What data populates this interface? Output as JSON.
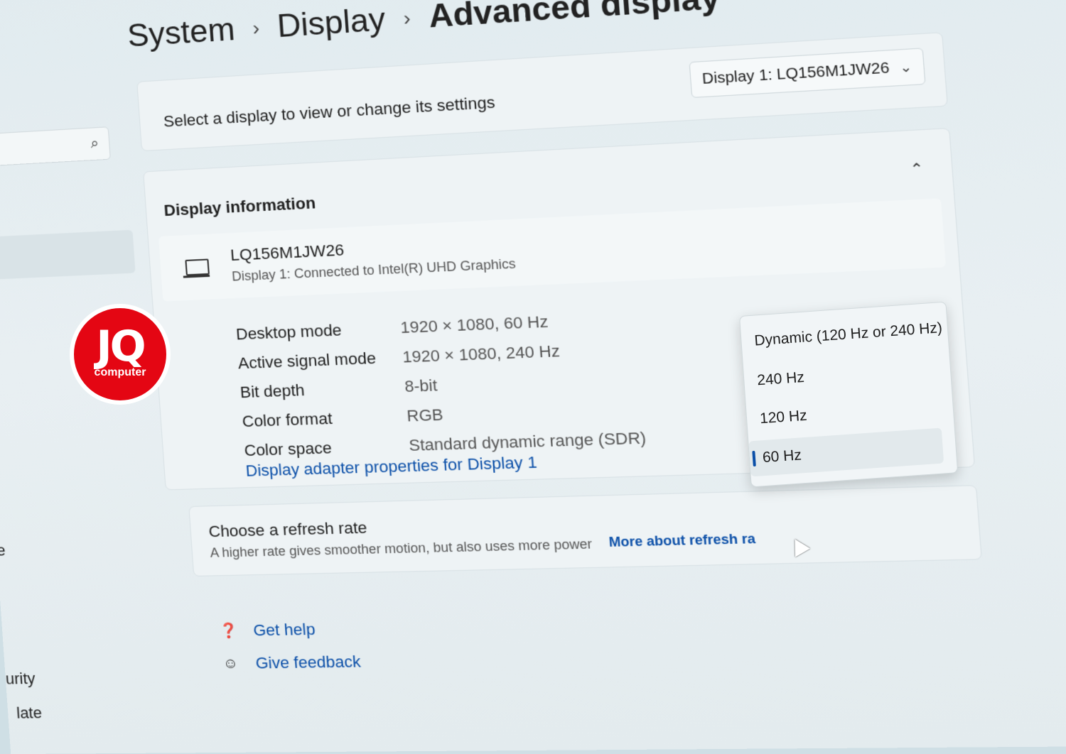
{
  "breadcrumb": {
    "items": [
      "System",
      "Display"
    ],
    "current": "Advanced display",
    "separator": "›"
  },
  "display_select": {
    "label": "Select a display to view or change its settings",
    "value": "Display 1: LQ156M1JW26"
  },
  "display_info": {
    "title": "Display information",
    "monitor_name": "LQ156M1JW26",
    "monitor_sub": "Display 1: Connected to Intel(R) UHD Graphics",
    "specs": [
      {
        "label": "Desktop mode",
        "value": "1920 × 1080, 60 Hz"
      },
      {
        "label": "Active signal mode",
        "value": "1920 × 1080, 240 Hz"
      },
      {
        "label": "Bit depth",
        "value": "8-bit"
      },
      {
        "label": "Color format",
        "value": "RGB"
      },
      {
        "label": "Color space",
        "value": "Standard dynamic range (SDR)"
      }
    ],
    "adapter_link": "Display adapter properties for Display 1"
  },
  "refresh": {
    "title": "Choose a refresh rate",
    "subtitle": "A higher rate gives smoother motion, but also uses more power",
    "more_link": "More about refresh ra",
    "options": [
      "Dynamic (120 Hz or 240 Hz)",
      "240 Hz",
      "120 Hz",
      "60 Hz"
    ],
    "selected": "60 Hz"
  },
  "help": {
    "get_help": "Get help",
    "give_feedback": "Give feedback"
  },
  "sidebar": {
    "partial_items": [
      "e",
      "urity",
      "late"
    ]
  },
  "watermark": {
    "main": "JQ",
    "sub": "computer"
  },
  "colors": {
    "accent": "#0b4fa8",
    "logo_red": "#e40613"
  }
}
